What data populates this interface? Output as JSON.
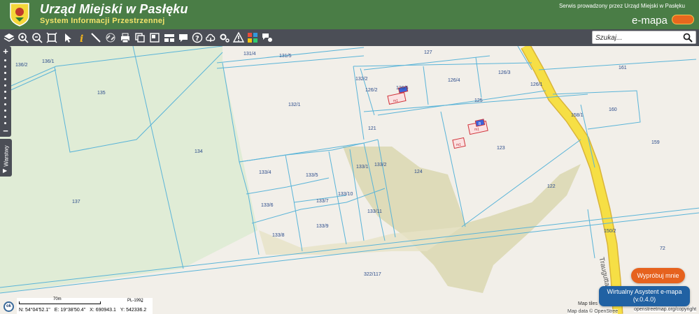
{
  "header": {
    "title": "Urząd Miejski w Pasłęku",
    "subtitle": "System Informacji Przestrzennej",
    "service_text": "Serwis prowadzony przez Urząd Miejski w Pasłęku",
    "brand": "e-mapa",
    "accent_color": "#4a7d46",
    "subtitle_color": "#f3e36a"
  },
  "toolbar": {
    "tools": [
      "layers-icon",
      "zoom-in-icon",
      "zoom-out-icon",
      "zoom-extent-icon",
      "select-arrow-icon",
      "info-icon",
      "measure-distance-icon",
      "link-icon",
      "print-icon",
      "copy-map-icon",
      "layout-icon",
      "comment-icon",
      "help-icon",
      "upload-icon",
      "settings-icon",
      "warning-icon",
      "color-palette-icon",
      "messages-icon"
    ]
  },
  "search": {
    "placeholder": "Szukaj..."
  },
  "side": {
    "layers_label": "Warstwy",
    "zoom_in": "+",
    "zoom_out": "−"
  },
  "map": {
    "plots": [
      "136/2",
      "136/1",
      "135",
      "134",
      "137",
      "131/4",
      "131/5",
      "127",
      "132/2",
      "126/2",
      "126/5",
      "126/4",
      "126/3",
      "126/1",
      "161",
      "132/1",
      "125",
      "158/1",
      "160",
      "121",
      "123",
      "159",
      "133/4",
      "133/5",
      "133/1",
      "133/2",
      "124",
      "122",
      "133/6",
      "133/7",
      "133/10",
      "133/11",
      "133/8",
      "133/9",
      "150/2",
      "72",
      "322/117"
    ],
    "building_labels": [
      "m1",
      "m1",
      "m1"
    ],
    "building_marker": "B",
    "street_name": "Traugutta",
    "road_color": "#f6df45"
  },
  "status": {
    "ok_label": "ok",
    "scale_text": "70m",
    "crs": "PL-1992",
    "lat": "N: 54°04'52.1\"",
    "lon": "E: 19°38'50.4\"",
    "x": "X: 690943.1",
    "y": "Y: 542336.2"
  },
  "attribution": {
    "tiles": "Map tiles",
    "data": "Map data © OpenStree",
    "osm": "openstreetmap.org/copyright"
  },
  "assistant": {
    "try_label": "Wypróbuj mnie",
    "name": "Wirtualny Asystent e-mapa",
    "version": "(v.0.4.0)"
  }
}
